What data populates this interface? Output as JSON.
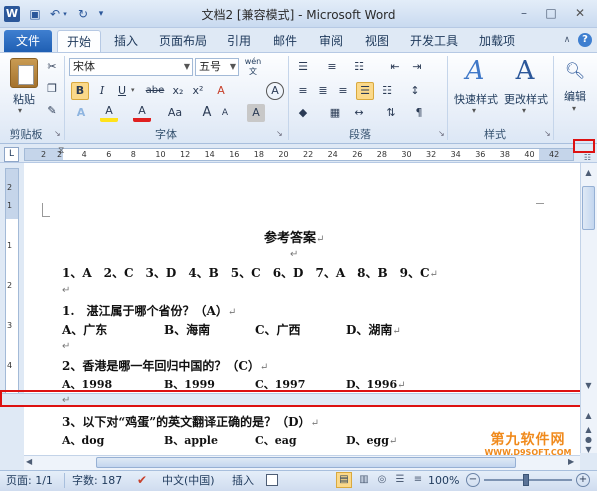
{
  "app": {
    "title": "文档2 [兼容模式] - Microsoft Word",
    "quick_access": [
      "W",
      "save",
      "undo",
      "redo"
    ]
  },
  "tabs": [
    "文件",
    "开始",
    "插入",
    "页面布局",
    "引用",
    "邮件",
    "审阅",
    "视图",
    "开发工具",
    "加载项"
  ],
  "ribbon": {
    "clipboard": {
      "paste": "粘贴",
      "group": "剪贴板"
    },
    "font": {
      "name": "宋体",
      "size": "五号",
      "wen": "wén\n文",
      "group": "字体",
      "bold": "B",
      "italic": "I",
      "underline": "U",
      "strike": "abe",
      "sub": "x₂",
      "sup": "x²",
      "clear": "A",
      "grow": "A",
      "shrink": "A",
      "aa": "Aa",
      "border_a": "A",
      "circle_a": "A",
      "highlight_a": "A",
      "color_a": "A"
    },
    "paragraph": {
      "group": "段落"
    },
    "styles": {
      "quick": "快速样式",
      "change": "更改样式",
      "group": "样式"
    },
    "editing": {
      "label": "编辑"
    }
  },
  "ruler": {
    "marks": [
      "2",
      "2",
      "4",
      "6",
      "8",
      "10",
      "12",
      "14",
      "16",
      "18",
      "20",
      "22",
      "24",
      "26",
      "28",
      "30",
      "32",
      "34",
      "36",
      "38",
      "40",
      "42"
    ],
    "vmarks": [
      "2",
      "1",
      "1",
      "2",
      "3",
      "4"
    ],
    "corner": "L"
  },
  "document": {
    "heading": "参考答案",
    "answers": "1、A　2、C　3、D　4、B　5、C　6、D　7、A　8、B　9、C",
    "q1": "1.　湛江属于哪个省份？（A）",
    "q1_opts": [
      "A、广东",
      "B、海南",
      "C、广西",
      "D、湖南"
    ],
    "q2": "2、香港是哪一年回归中国的？（C）",
    "q2_opts": [
      "A、1998",
      "B、1999",
      "C、1997",
      "D、1996"
    ],
    "q3": "3、以下对“鸡蛋”的英文翻译正确的是？（D）",
    "q3_opts": [
      "A、dog",
      "B、apple",
      "C、eag",
      "D、egg"
    ],
    "para_mark": "↵"
  },
  "status": {
    "page": "页面: 1/1",
    "words": "字数: 187",
    "lang": "中文(中国)",
    "mode": "插入",
    "zoom": "100%"
  },
  "watermark": {
    "name": "第九软件网",
    "url": "WWW.D9SOFT.COM"
  },
  "colors": {
    "accent": "#2b579a",
    "highlight_box": "#dd1111",
    "file_tab": "#2f6fc2"
  }
}
